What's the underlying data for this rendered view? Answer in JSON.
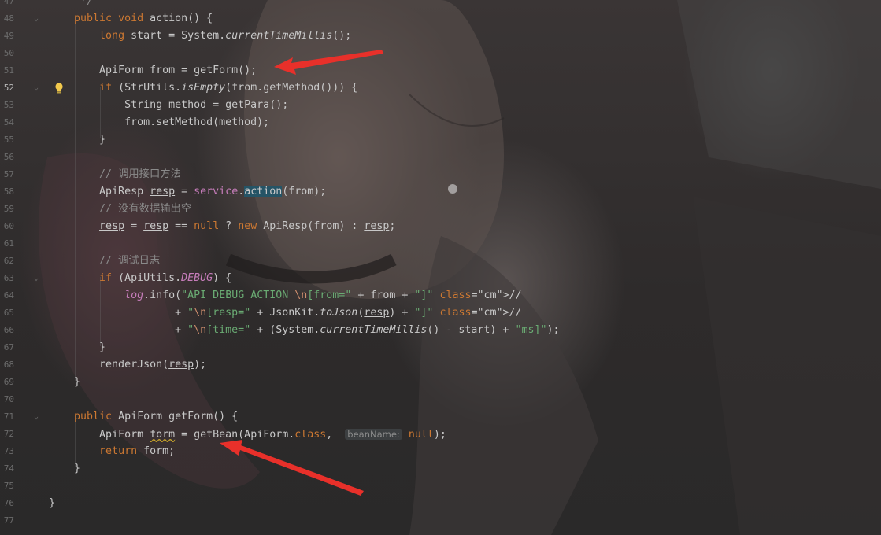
{
  "editor": {
    "current_line": "52",
    "lines": [
      {
        "num": "47",
        "fold": "",
        "text": "     */"
      },
      {
        "num": "48",
        "fold": "⌄",
        "text": "    public void action() {"
      },
      {
        "num": "49",
        "fold": "",
        "text": "        long start = System.currentTimeMillis();"
      },
      {
        "num": "50",
        "fold": "",
        "text": ""
      },
      {
        "num": "51",
        "fold": "",
        "text": "        ApiForm from = getForm();"
      },
      {
        "num": "52",
        "fold": "⌄",
        "text": "        if (StrUtils.isEmpty(from.getMethod())) {"
      },
      {
        "num": "53",
        "fold": "",
        "text": "            String method = getPara();"
      },
      {
        "num": "54",
        "fold": "",
        "text": "            from.setMethod(method);"
      },
      {
        "num": "55",
        "fold": "",
        "text": "        }"
      },
      {
        "num": "56",
        "fold": "",
        "text": ""
      },
      {
        "num": "57",
        "fold": "",
        "text": "        // 调用接口方法"
      },
      {
        "num": "58",
        "fold": "",
        "text": "        ApiResp resp = service.action(from);"
      },
      {
        "num": "59",
        "fold": "",
        "text": "        // 没有数据输出空"
      },
      {
        "num": "60",
        "fold": "",
        "text": "        resp = resp == null ? new ApiResp(from) : resp;"
      },
      {
        "num": "61",
        "fold": "",
        "text": ""
      },
      {
        "num": "62",
        "fold": "",
        "text": "        // 调试日志"
      },
      {
        "num": "63",
        "fold": "⌄",
        "text": "        if (ApiUtils.DEBUG) {"
      },
      {
        "num": "64",
        "fold": "",
        "text": "            log.info(\"API DEBUG ACTION \\n[from=\" + from + \"]\" //"
      },
      {
        "num": "65",
        "fold": "",
        "text": "                    + \"\\n[resp=\" + JsonKit.toJson(resp) + \"]\" //"
      },
      {
        "num": "66",
        "fold": "",
        "text": "                    + \"\\n[time=\" + (System.currentTimeMillis() - start) + \"ms]\");"
      },
      {
        "num": "67",
        "fold": "",
        "text": "        }"
      },
      {
        "num": "68",
        "fold": "",
        "text": "        renderJson(resp);"
      },
      {
        "num": "69",
        "fold": "",
        "text": "    }"
      },
      {
        "num": "70",
        "fold": "",
        "text": ""
      },
      {
        "num": "71",
        "fold": "⌄",
        "text": "    public ApiForm getForm() {"
      },
      {
        "num": "72",
        "fold": "",
        "text": "        ApiForm form = getBean(ApiForm.class,  beanName: null);"
      },
      {
        "num": "73",
        "fold": "",
        "text": "        return form;"
      },
      {
        "num": "74",
        "fold": "",
        "text": "    }"
      },
      {
        "num": "75",
        "fold": "",
        "text": ""
      },
      {
        "num": "76",
        "fold": "",
        "text": "}"
      },
      {
        "num": "77",
        "fold": "",
        "text": ""
      }
    ],
    "param_hint": "beanName:"
  },
  "colors": {
    "keyword": "#cc7832",
    "method": "#56a8f5",
    "string": "#6aab73",
    "comment": "#8a8a8a",
    "field": "#c77dbb",
    "annotation_arrow": "#e8302a"
  },
  "icons": {
    "intention": "lightbulb-icon",
    "fold": "chevron-down-icon"
  }
}
